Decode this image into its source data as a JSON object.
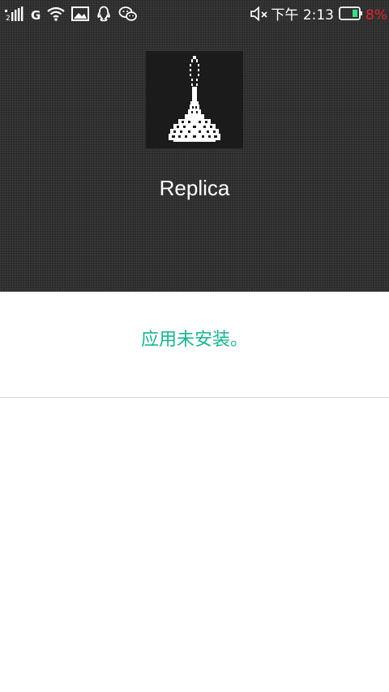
{
  "status_bar": {
    "sim_slot": "2",
    "network_type": "G",
    "time": "下午 2:13",
    "battery_percent": "8%",
    "icons": [
      "signal-icon",
      "wifi-icon",
      "image-notification-icon",
      "qq-icon",
      "wechat-icon",
      "mute-icon",
      "battery-icon"
    ]
  },
  "app": {
    "name": "Replica",
    "icon": "rocket-icon"
  },
  "message": {
    "text": "应用未安装。"
  },
  "colors": {
    "panel_background": "#2b2b2b",
    "message_text": "#1ab394",
    "battery_low": "#e8212a",
    "battery_fill": "#3ddc84"
  }
}
